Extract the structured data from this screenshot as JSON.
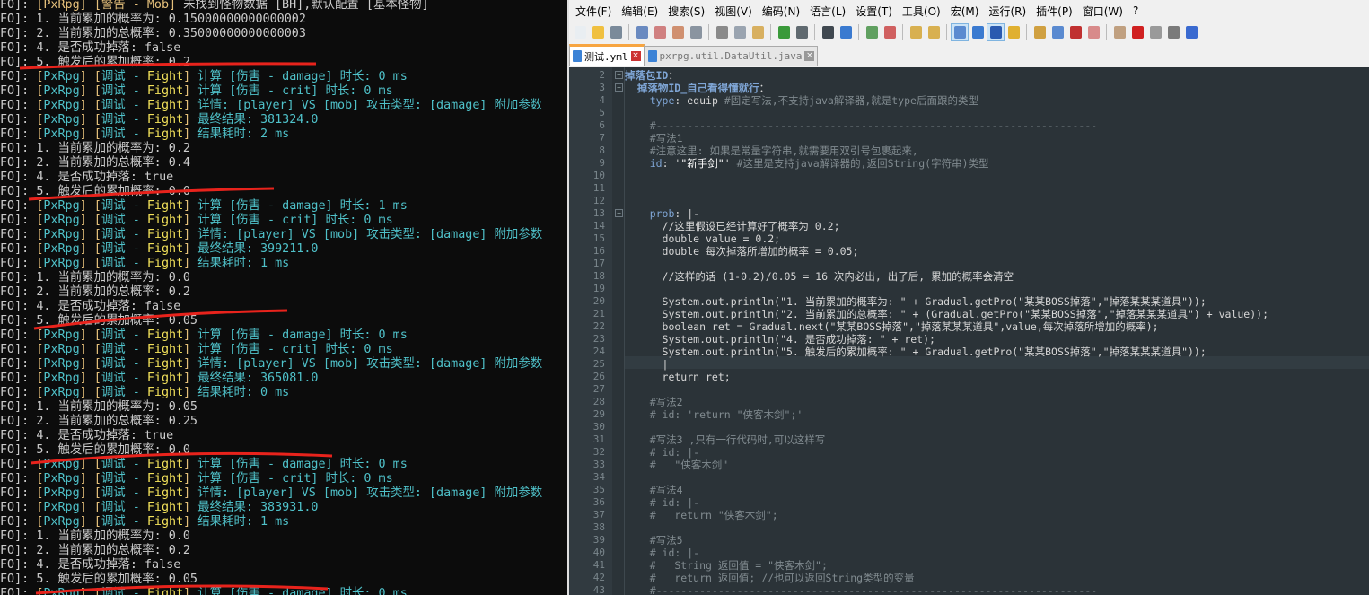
{
  "console": {
    "prefix": "FO]: ",
    "lines": [
      {
        "type": "warn",
        "tag": "[PxRpg]",
        "cat": "[警告 - Mob]",
        "msg": "未找到怪物数据 [BH],默认配置 [基本怪物]"
      },
      {
        "type": "plain",
        "msg": "1. 当前累加的概率为: 0.15000000000000002"
      },
      {
        "type": "plain",
        "msg": "2. 当前累加的总概率: 0.35000000000000003"
      },
      {
        "type": "plain",
        "msg": "4. 是否成功掉落: false"
      },
      {
        "type": "plain",
        "msg": "5. 触发后的累加概率: 0.2"
      },
      {
        "type": "fight",
        "msg": "计算 [伤害 - damage] 时长: 0 ms"
      },
      {
        "type": "fight",
        "msg": "计算 [伤害 - crit] 时长: 0 ms"
      },
      {
        "type": "fight",
        "msg": "详情: [player] VS [mob] 攻击类型: [damage] 附加参数"
      },
      {
        "type": "fight",
        "msg": "最终结果: 381324.0"
      },
      {
        "type": "fight",
        "msg": "结果耗时: 2 ms"
      },
      {
        "type": "plain",
        "msg": "1. 当前累加的概率为: 0.2"
      },
      {
        "type": "plain",
        "msg": "2. 当前累加的总概率: 0.4"
      },
      {
        "type": "plain",
        "msg": "4. 是否成功掉落: true"
      },
      {
        "type": "plain",
        "msg": "5. 触发后的累加概率: 0.0"
      },
      {
        "type": "fight",
        "msg": "计算 [伤害 - damage] 时长: 1 ms"
      },
      {
        "type": "fight",
        "msg": "计算 [伤害 - crit] 时长: 0 ms"
      },
      {
        "type": "fight",
        "msg": "详情: [player] VS [mob] 攻击类型: [damage] 附加参数"
      },
      {
        "type": "fight",
        "msg": "最终结果: 399211.0"
      },
      {
        "type": "fight",
        "msg": "结果耗时: 1 ms"
      },
      {
        "type": "plain",
        "msg": "1. 当前累加的概率为: 0.0"
      },
      {
        "type": "plain",
        "msg": "2. 当前累加的总概率: 0.2"
      },
      {
        "type": "plain",
        "msg": "4. 是否成功掉落: false"
      },
      {
        "type": "plain",
        "msg": "5. 触发后的累加概率: 0.05"
      },
      {
        "type": "fight",
        "msg": "计算 [伤害 - damage] 时长: 0 ms"
      },
      {
        "type": "fight",
        "msg": "计算 [伤害 - crit] 时长: 0 ms"
      },
      {
        "type": "fight",
        "msg": "详情: [player] VS [mob] 攻击类型: [damage] 附加参数"
      },
      {
        "type": "fight",
        "msg": "最终结果: 365081.0"
      },
      {
        "type": "fight",
        "msg": "结果耗时: 0 ms"
      },
      {
        "type": "plain",
        "msg": "1. 当前累加的概率为: 0.05"
      },
      {
        "type": "plain",
        "msg": "2. 当前累加的总概率: 0.25"
      },
      {
        "type": "plain",
        "msg": "4. 是否成功掉落: true"
      },
      {
        "type": "plain",
        "msg": "5. 触发后的累加概率: 0.0"
      },
      {
        "type": "fight",
        "msg": "计算 [伤害 - damage] 时长: 0 ms"
      },
      {
        "type": "fight",
        "msg": "计算 [伤害 - crit] 时长: 0 ms"
      },
      {
        "type": "fight",
        "msg": "详情: [player] VS [mob] 攻击类型: [damage] 附加参数"
      },
      {
        "type": "fight",
        "msg": "最终结果: 383931.0"
      },
      {
        "type": "fight",
        "msg": "结果耗时: 1 ms"
      },
      {
        "type": "plain",
        "msg": "1. 当前累加的概率为: 0.0"
      },
      {
        "type": "plain",
        "msg": "2. 当前累加的总概率: 0.2"
      },
      {
        "type": "plain",
        "msg": "4. 是否成功掉落: false"
      },
      {
        "type": "plain",
        "msg": "5. 触发后的累加概率: 0.05"
      },
      {
        "type": "fight",
        "msg": "计算 [伤害 - damage] 时长: 0 ms"
      }
    ],
    "fight_tag": "PxRpg",
    "fight_cat": "调试",
    "fight_sub": "Fight"
  },
  "editor": {
    "menu": [
      "文件(F)",
      "编辑(E)",
      "搜索(S)",
      "视图(V)",
      "编码(N)",
      "语言(L)",
      "设置(T)",
      "工具(O)",
      "宏(M)",
      "运行(R)",
      "插件(P)",
      "窗口(W)",
      "?"
    ],
    "toolbar": [
      "new-file",
      "open-file",
      "save",
      "save-all",
      "close",
      "close-all",
      "print",
      "cut",
      "copy",
      "paste",
      "undo",
      "redo",
      "find",
      "replace",
      "zoom-in",
      "zoom-out",
      "sync-v",
      "sync-h",
      "word-wrap",
      "show-all-chars",
      "indent-guide",
      "udl",
      "doc-map",
      "function-list",
      "folder-workspace",
      "monitor",
      "record-macro",
      "stop-record",
      "play-macro",
      "run-macro-multiple",
      "save-macro"
    ],
    "tabs": [
      {
        "label": "测试.yml",
        "active": true
      },
      {
        "label": "pxrpg.util.DataUtil.java",
        "active": false
      }
    ],
    "first_line": 2,
    "lines": [
      [
        [
          "kb",
          "掉落包ID"
        ],
        [
          "",
          "："
        ]
      ],
      [
        [
          "",
          "  "
        ],
        [
          "kb",
          "掉落物ID_自己看得懂就行"
        ],
        [
          "",
          "："
        ]
      ],
      [
        [
          "",
          "    "
        ],
        [
          "k",
          "type"
        ],
        [
          "",
          ": equip "
        ],
        [
          "cm",
          "#固定写法,不支持java解译器,就是type后面跟的类型"
        ]
      ],
      [],
      [
        [
          "cm",
          "    #-----------------------------------------------------------------------"
        ]
      ],
      [
        [
          "cm",
          "    #写法1"
        ]
      ],
      [
        [
          "cm",
          "    #注意这里: 如果是常量字符串,就需要用双引号包裹起来,"
        ]
      ],
      [
        [
          "",
          "    "
        ],
        [
          "k",
          "id"
        ],
        [
          "",
          ": '"
        ],
        [
          "s",
          "\"新手剑\""
        ],
        [
          "",
          "' "
        ],
        [
          "cm",
          "#这里是支持java解译器的,返回String(字符串)类型"
        ]
      ],
      [],
      [],
      [],
      [
        [
          "",
          "    "
        ],
        [
          "k",
          "prob"
        ],
        [
          "",
          ": |-"
        ]
      ],
      [
        [
          "",
          "      //这里假设已经计算好了概率为 0.2;"
        ]
      ],
      [
        [
          "",
          "      double value = 0.2;"
        ]
      ],
      [
        [
          "",
          "      double 每次掉落所增加的概率 = 0.05;"
        ]
      ],
      [],
      [
        [
          "",
          "      //这样的话 (1-0.2)/0.05 = 16 次内必出, 出了后, 累加的概率会清空"
        ]
      ],
      [],
      [
        [
          "",
          "      System.out.println(\"1. 当前累加的概率为: \" + Gradual.getPro(\"某某BOSS掉落\",\"掉落某某某道具\"));"
        ]
      ],
      [
        [
          "",
          "      System.out.println(\"2. 当前累加的总概率: \" + (Gradual.getPro(\"某某BOSS掉落\",\"掉落某某某道具\") + value));"
        ]
      ],
      [
        [
          "",
          "      boolean ret = Gradual.next(\"某某BOSS掉落\",\"掉落某某某道具\",value,每次掉落所增加的概率);"
        ]
      ],
      [
        [
          "",
          "      System.out.println(\"4. 是否成功掉落: \" + ret);"
        ]
      ],
      [
        [
          "",
          "      System.out.println(\"5. 触发后的累加概率: \" + Gradual.getPro(\"某某BOSS掉落\",\"掉落某某某道具\"));"
        ]
      ],
      [
        [
          "",
          "      |"
        ]
      ],
      [
        [
          "",
          "      return ret;"
        ]
      ],
      [],
      [
        [
          "cm",
          "    #写法2"
        ]
      ],
      [
        [
          "cm",
          "    # id: 'return \"侠客木剑\";'"
        ]
      ],
      [],
      [
        [
          "cm",
          "    #写法3 ,只有一行代码时,可以这样写"
        ]
      ],
      [
        [
          "cm",
          "    # id: |-"
        ]
      ],
      [
        [
          "cm",
          "    #   \"侠客木剑\""
        ]
      ],
      [],
      [
        [
          "cm",
          "    #写法4"
        ]
      ],
      [
        [
          "cm",
          "    # id: |-"
        ]
      ],
      [
        [
          "cm",
          "    #   return \"侠客木剑\";"
        ]
      ],
      [],
      [
        [
          "cm",
          "    #写法5"
        ]
      ],
      [
        [
          "cm",
          "    # id: |-"
        ]
      ],
      [
        [
          "cm",
          "    #   String 返回值 = \"侠客木剑\";"
        ]
      ],
      [
        [
          "cm",
          "    #   return 返回值; //也可以返回String类型的变量"
        ]
      ],
      [
        [
          "cm",
          "    #-----------------------------------------------------------------------"
        ]
      ]
    ]
  }
}
